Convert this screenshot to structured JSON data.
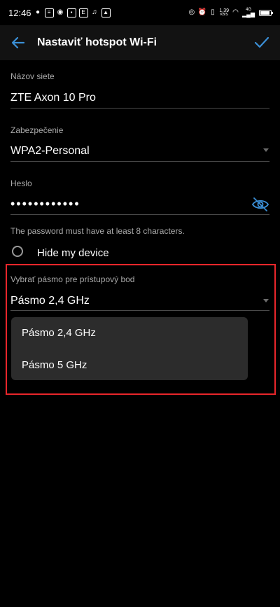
{
  "status_bar": {
    "time": "12:46",
    "speed": "1,39",
    "speed_unit": "KB/S",
    "network_type": "4G"
  },
  "header": {
    "title": "Nastaviť hotspot Wi-Fi",
    "back_icon": "arrow-left-icon",
    "confirm_icon": "check-icon",
    "accent_color": "#3b8fd6"
  },
  "fields": {
    "network_name": {
      "label": "Názov siete",
      "value": "ZTE Axon 10 Pro"
    },
    "security": {
      "label": "Zabezpečenie",
      "value": "WPA2-Personal"
    },
    "password": {
      "label": "Heslo",
      "value": "••••••••••••"
    }
  },
  "helper_text": "The password must have at least 8 characters.",
  "hide_device": {
    "label": "Hide my device"
  },
  "band": {
    "label": "Vybrať pásmo pre prístupový bod",
    "value": "Pásmo 2,4 GHz",
    "options": [
      "Pásmo 2,4 GHz",
      "Pásmo 5 GHz"
    ]
  },
  "highlight_color": "#e8262b"
}
